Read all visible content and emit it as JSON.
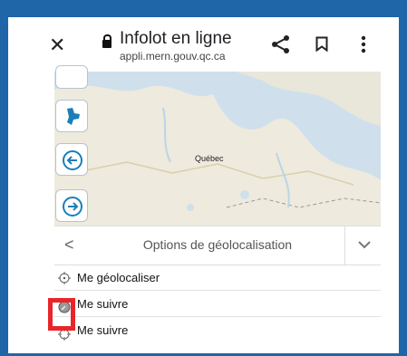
{
  "browser": {
    "title": "Infolot en ligne",
    "url": "appli.mern.gouv.qc.ca"
  },
  "map": {
    "place_label": "Québec"
  },
  "panel": {
    "title": "Options de géolocalisation",
    "options": [
      {
        "label": "Me géolocaliser",
        "icon": "crosshair-icon"
      },
      {
        "label": "Me suivre",
        "icon": "compass-icon"
      },
      {
        "label": "Me suivre",
        "icon": "crosshair-icon"
      }
    ]
  },
  "colors": {
    "frame": "#1f66a8",
    "highlight": "#e8262a",
    "tool_accent": "#1a7fb8"
  }
}
